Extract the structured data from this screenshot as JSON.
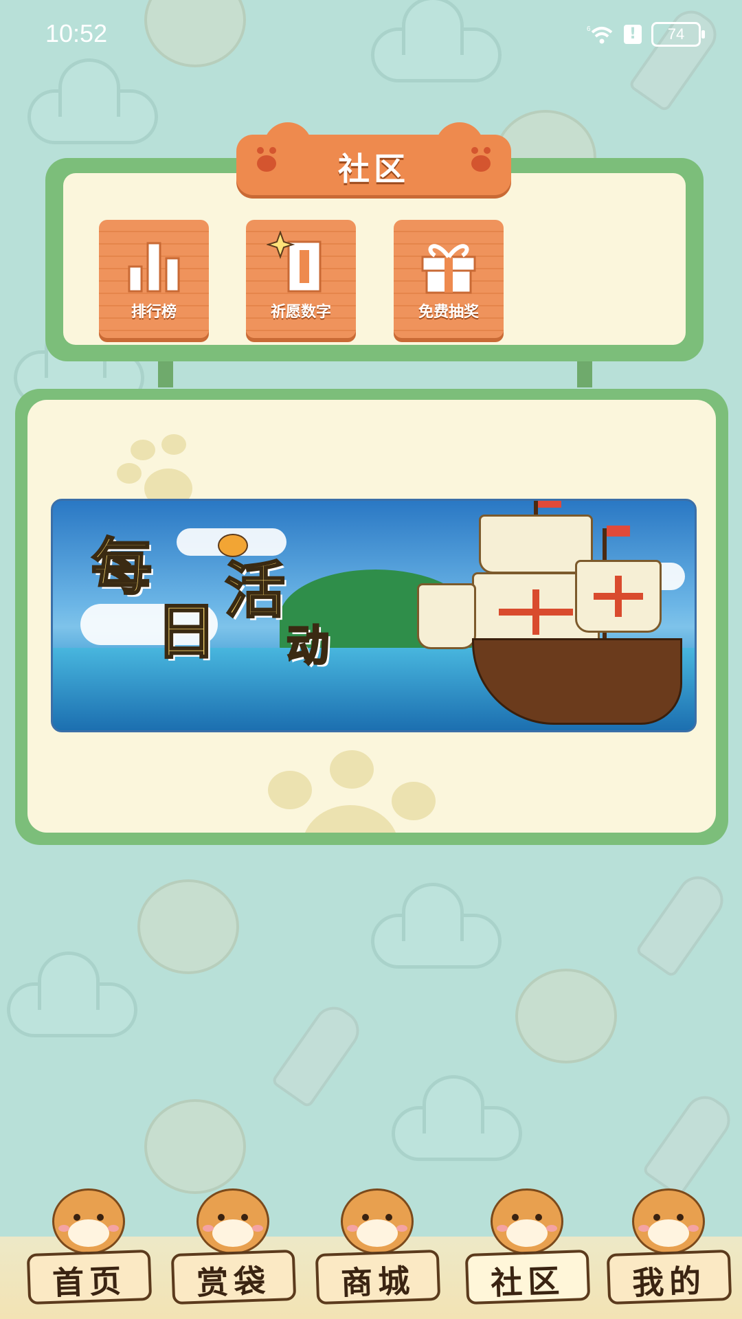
{
  "status_bar": {
    "time": "10:52",
    "battery": "74",
    "network": "6"
  },
  "community": {
    "title": "社区",
    "tiles": [
      {
        "label": "排行榜",
        "icon": "bar-chart-icon"
      },
      {
        "label": "祈愿数字",
        "icon": "wish-number-icon"
      },
      {
        "label": "免费抽奖",
        "icon": "gift-icon"
      }
    ]
  },
  "activity": {
    "banner_chars": [
      "每",
      "活",
      "日",
      "动"
    ]
  },
  "nav": {
    "items": [
      {
        "label": "首页"
      },
      {
        "label": "赏袋"
      },
      {
        "label": "商城"
      },
      {
        "label": "社区",
        "active": true
      },
      {
        "label": "我的"
      }
    ]
  },
  "colors": {
    "background": "#b8e0d8",
    "panel_green": "#7cbe7a",
    "tile_orange": "#ee8a4e",
    "panel_cream": "#fbf6dc"
  }
}
